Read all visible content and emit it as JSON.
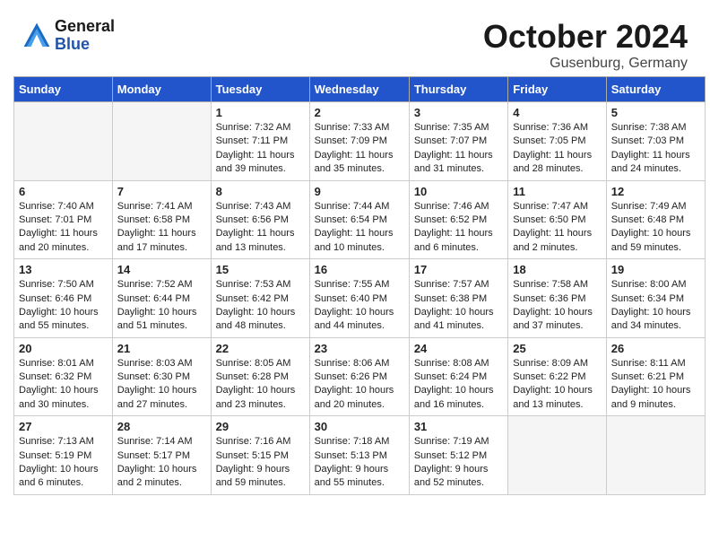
{
  "header": {
    "logo_line1": "General",
    "logo_line2": "Blue",
    "month": "October 2024",
    "location": "Gusenburg, Germany"
  },
  "days_of_week": [
    "Sunday",
    "Monday",
    "Tuesday",
    "Wednesday",
    "Thursday",
    "Friday",
    "Saturday"
  ],
  "weeks": [
    [
      {
        "day": "",
        "info": ""
      },
      {
        "day": "",
        "info": ""
      },
      {
        "day": "1",
        "info": "Sunrise: 7:32 AM\nSunset: 7:11 PM\nDaylight: 11 hours and 39 minutes."
      },
      {
        "day": "2",
        "info": "Sunrise: 7:33 AM\nSunset: 7:09 PM\nDaylight: 11 hours and 35 minutes."
      },
      {
        "day": "3",
        "info": "Sunrise: 7:35 AM\nSunset: 7:07 PM\nDaylight: 11 hours and 31 minutes."
      },
      {
        "day": "4",
        "info": "Sunrise: 7:36 AM\nSunset: 7:05 PM\nDaylight: 11 hours and 28 minutes."
      },
      {
        "day": "5",
        "info": "Sunrise: 7:38 AM\nSunset: 7:03 PM\nDaylight: 11 hours and 24 minutes."
      }
    ],
    [
      {
        "day": "6",
        "info": "Sunrise: 7:40 AM\nSunset: 7:01 PM\nDaylight: 11 hours and 20 minutes."
      },
      {
        "day": "7",
        "info": "Sunrise: 7:41 AM\nSunset: 6:58 PM\nDaylight: 11 hours and 17 minutes."
      },
      {
        "day": "8",
        "info": "Sunrise: 7:43 AM\nSunset: 6:56 PM\nDaylight: 11 hours and 13 minutes."
      },
      {
        "day": "9",
        "info": "Sunrise: 7:44 AM\nSunset: 6:54 PM\nDaylight: 11 hours and 10 minutes."
      },
      {
        "day": "10",
        "info": "Sunrise: 7:46 AM\nSunset: 6:52 PM\nDaylight: 11 hours and 6 minutes."
      },
      {
        "day": "11",
        "info": "Sunrise: 7:47 AM\nSunset: 6:50 PM\nDaylight: 11 hours and 2 minutes."
      },
      {
        "day": "12",
        "info": "Sunrise: 7:49 AM\nSunset: 6:48 PM\nDaylight: 10 hours and 59 minutes."
      }
    ],
    [
      {
        "day": "13",
        "info": "Sunrise: 7:50 AM\nSunset: 6:46 PM\nDaylight: 10 hours and 55 minutes."
      },
      {
        "day": "14",
        "info": "Sunrise: 7:52 AM\nSunset: 6:44 PM\nDaylight: 10 hours and 51 minutes."
      },
      {
        "day": "15",
        "info": "Sunrise: 7:53 AM\nSunset: 6:42 PM\nDaylight: 10 hours and 48 minutes."
      },
      {
        "day": "16",
        "info": "Sunrise: 7:55 AM\nSunset: 6:40 PM\nDaylight: 10 hours and 44 minutes."
      },
      {
        "day": "17",
        "info": "Sunrise: 7:57 AM\nSunset: 6:38 PM\nDaylight: 10 hours and 41 minutes."
      },
      {
        "day": "18",
        "info": "Sunrise: 7:58 AM\nSunset: 6:36 PM\nDaylight: 10 hours and 37 minutes."
      },
      {
        "day": "19",
        "info": "Sunrise: 8:00 AM\nSunset: 6:34 PM\nDaylight: 10 hours and 34 minutes."
      }
    ],
    [
      {
        "day": "20",
        "info": "Sunrise: 8:01 AM\nSunset: 6:32 PM\nDaylight: 10 hours and 30 minutes."
      },
      {
        "day": "21",
        "info": "Sunrise: 8:03 AM\nSunset: 6:30 PM\nDaylight: 10 hours and 27 minutes."
      },
      {
        "day": "22",
        "info": "Sunrise: 8:05 AM\nSunset: 6:28 PM\nDaylight: 10 hours and 23 minutes."
      },
      {
        "day": "23",
        "info": "Sunrise: 8:06 AM\nSunset: 6:26 PM\nDaylight: 10 hours and 20 minutes."
      },
      {
        "day": "24",
        "info": "Sunrise: 8:08 AM\nSunset: 6:24 PM\nDaylight: 10 hours and 16 minutes."
      },
      {
        "day": "25",
        "info": "Sunrise: 8:09 AM\nSunset: 6:22 PM\nDaylight: 10 hours and 13 minutes."
      },
      {
        "day": "26",
        "info": "Sunrise: 8:11 AM\nSunset: 6:21 PM\nDaylight: 10 hours and 9 minutes."
      }
    ],
    [
      {
        "day": "27",
        "info": "Sunrise: 7:13 AM\nSunset: 5:19 PM\nDaylight: 10 hours and 6 minutes."
      },
      {
        "day": "28",
        "info": "Sunrise: 7:14 AM\nSunset: 5:17 PM\nDaylight: 10 hours and 2 minutes."
      },
      {
        "day": "29",
        "info": "Sunrise: 7:16 AM\nSunset: 5:15 PM\nDaylight: 9 hours and 59 minutes."
      },
      {
        "day": "30",
        "info": "Sunrise: 7:18 AM\nSunset: 5:13 PM\nDaylight: 9 hours and 55 minutes."
      },
      {
        "day": "31",
        "info": "Sunrise: 7:19 AM\nSunset: 5:12 PM\nDaylight: 9 hours and 52 minutes."
      },
      {
        "day": "",
        "info": ""
      },
      {
        "day": "",
        "info": ""
      }
    ]
  ]
}
